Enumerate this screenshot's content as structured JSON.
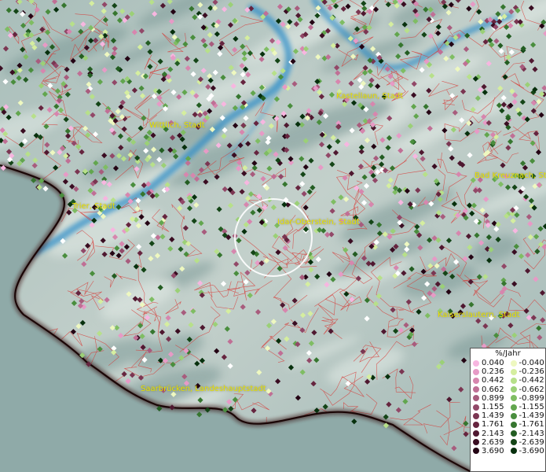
{
  "map": {
    "cities": [
      {
        "name": "Kastellaun, Stadt"
      },
      {
        "name": "Wittlich, Stadt"
      },
      {
        "name": "Bad Kreuznach, St"
      },
      {
        "name": "Trier, Stadt"
      },
      {
        "name": "Idar-Oberstein, Stadt"
      },
      {
        "name": "Kaiserslautern, Stadt"
      },
      {
        "name": "Saarbrücken, Landeshauptstadt"
      }
    ],
    "colors": {
      "background": "#9fb6b4",
      "terrain_light": "#c4d1cc",
      "water": "#2f8fc5",
      "boundaries": "#d9322e",
      "outside_border": "#8faaa8",
      "label": "#e8e000"
    },
    "highlight": "white circle around Idar-Oberstein"
  },
  "legend": {
    "title": "%/Jahr",
    "positive": [
      {
        "value": "0.040",
        "color": "#f7b6e0"
      },
      {
        "value": "0.236",
        "color": "#e79ac6"
      },
      {
        "value": "0.442",
        "color": "#d786ae"
      },
      {
        "value": "0.662",
        "color": "#c06f95"
      },
      {
        "value": "0.899",
        "color": "#a85c7d"
      },
      {
        "value": "1.155",
        "color": "#924868"
      },
      {
        "value": "1.439",
        "color": "#7b3652"
      },
      {
        "value": "1.761",
        "color": "#66253f"
      },
      {
        "value": "2.143",
        "color": "#4f1830"
      },
      {
        "value": "2.639",
        "color": "#3a0d22"
      },
      {
        "value": "3.690",
        "color": "#240414"
      }
    ],
    "negative": [
      {
        "value": "-0.040",
        "color": "#eef8c0"
      },
      {
        "value": "-0.236",
        "color": "#d5ee9f"
      },
      {
        "value": "-0.442",
        "color": "#b7e08a"
      },
      {
        "value": "-0.662",
        "color": "#9bd077"
      },
      {
        "value": "-0.899",
        "color": "#7fbd63"
      },
      {
        "value": "-1.155",
        "color": "#62a64e"
      },
      {
        "value": "-1.439",
        "color": "#4a8e3e"
      },
      {
        "value": "-1.761",
        "color": "#36762f"
      },
      {
        "value": "-2.143",
        "color": "#235d22"
      },
      {
        "value": "-2.639",
        "color": "#144517"
      },
      {
        "value": "-3.690",
        "color": "#07300d"
      }
    ]
  }
}
